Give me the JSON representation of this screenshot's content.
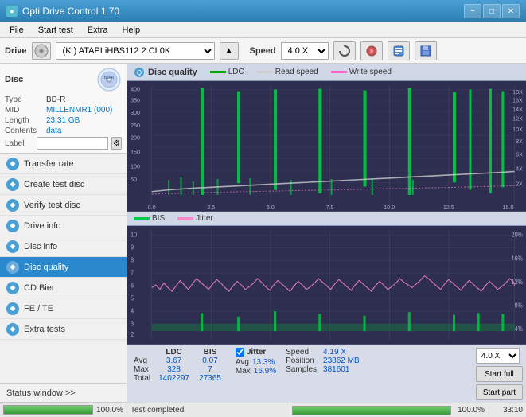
{
  "titlebar": {
    "title": "Opti Drive Control 1.70",
    "min": "−",
    "max": "□",
    "close": "✕"
  },
  "menubar": {
    "items": [
      "File",
      "Start test",
      "Extra",
      "Help"
    ]
  },
  "drivebar": {
    "label": "Drive",
    "drive_value": "(K:)  ATAPI  iHBS112  2 CL0K",
    "speed_label": "Speed",
    "speed_value": "4.0 X"
  },
  "disc": {
    "title": "Disc",
    "type_label": "Type",
    "type_value": "BD-R",
    "mid_label": "MID",
    "mid_value": "MILLENMR1 (000)",
    "length_label": "Length",
    "length_value": "23.31 GB",
    "contents_label": "Contents",
    "contents_value": "data",
    "label_label": "Label",
    "label_value": ""
  },
  "nav": {
    "items": [
      {
        "id": "transfer-rate",
        "label": "Transfer rate",
        "active": false
      },
      {
        "id": "create-test-disc",
        "label": "Create test disc",
        "active": false
      },
      {
        "id": "verify-test-disc",
        "label": "Verify test disc",
        "active": false
      },
      {
        "id": "drive-info",
        "label": "Drive info",
        "active": false
      },
      {
        "id": "disc-info",
        "label": "Disc info",
        "active": false
      },
      {
        "id": "disc-quality",
        "label": "Disc quality",
        "active": true
      },
      {
        "id": "cd-bier",
        "label": "CD Bier",
        "active": false
      },
      {
        "id": "fe-te",
        "label": "FE / TE",
        "active": false
      },
      {
        "id": "extra-tests",
        "label": "Extra tests",
        "active": false
      }
    ]
  },
  "status_window_btn": "Status window >>",
  "progress": {
    "percent": "100.0%",
    "fill_width": "100"
  },
  "quality": {
    "header_title": "Disc quality",
    "legend": {
      "ldc": "LDC",
      "read": "Read speed",
      "write": "Write speed",
      "bis": "BIS",
      "jitter": "Jitter"
    }
  },
  "stats": {
    "columns": [
      "",
      "LDC",
      "BIS"
    ],
    "avg_label": "Avg",
    "avg_ldc": "3.67",
    "avg_bis": "0.07",
    "max_label": "Max",
    "max_ldc": "328",
    "max_bis": "7",
    "total_label": "Total",
    "total_ldc": "1402297",
    "total_bis": "27365",
    "jitter_label": "Jitter",
    "jitter_avg": "13.3%",
    "jitter_max": "16.9%",
    "speed_label": "Speed",
    "speed_value": "4.19 X",
    "speed_select": "4.0 X",
    "position_label": "Position",
    "position_value": "23862 MB",
    "samples_label": "Samples",
    "samples_value": "381601",
    "start_full_btn": "Start full",
    "start_part_btn": "Start part"
  },
  "bottom": {
    "status_text": "Test completed",
    "progress_fill": "100",
    "progress_text": "100.0%",
    "time": "33:10"
  },
  "colors": {
    "accent_blue": "#4a9fd4",
    "active_nav": "#2a88cc",
    "chart_bg": "#2a2a4a",
    "ldc_green": "#00cc00",
    "read_gray": "#cccccc",
    "write_pink": "#ff66cc",
    "bis_green": "#00cc00",
    "jitter_pink": "#ff88cc",
    "progress_green": "#3a9a3a"
  }
}
